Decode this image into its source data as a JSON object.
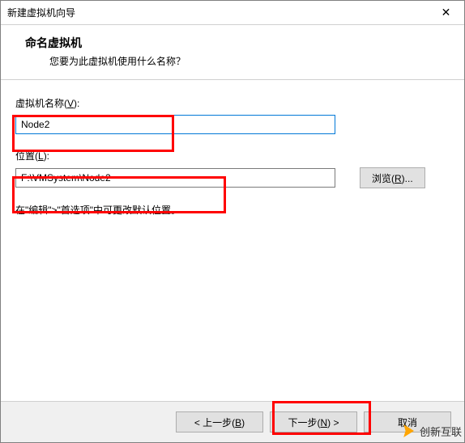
{
  "window": {
    "title": "新建虚拟机向导",
    "close_glyph": "✕"
  },
  "header": {
    "title": "命名虚拟机",
    "subtitle": "您要为此虚拟机使用什么名称？"
  },
  "fields": {
    "name_label_pre": "虚拟机名称(",
    "name_label_key": "V",
    "name_label_post": "):",
    "name_value": "Node2",
    "location_label_pre": "位置(",
    "location_label_key": "L",
    "location_label_post": "):",
    "location_value": "F:\\VMSystem\\Node2",
    "browse_pre": "浏览(",
    "browse_key": "R",
    "browse_post": ")..."
  },
  "hint": "在\"编辑\">\"首选项\"中可更改默认位置。",
  "footer": {
    "back_pre": "< 上一步(",
    "back_key": "B",
    "back_post": ")",
    "next_pre": "下一步(",
    "next_key": "N",
    "next_post": ") >",
    "cancel": "取消"
  },
  "watermark": "创新互联"
}
